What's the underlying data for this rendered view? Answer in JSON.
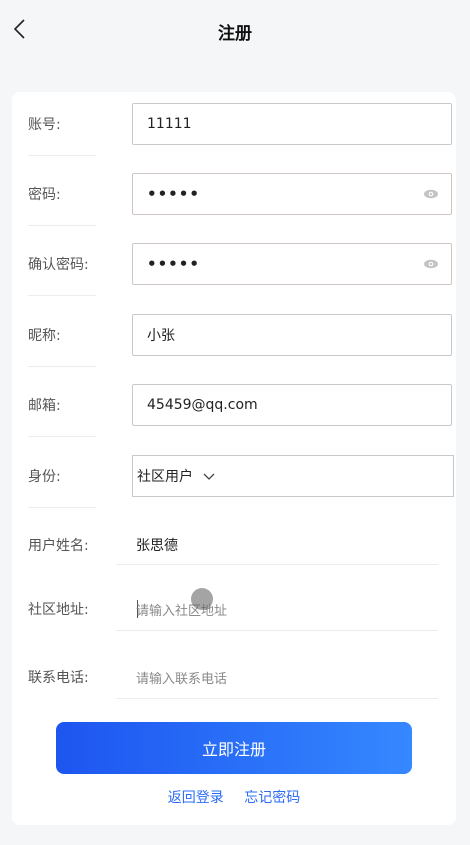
{
  "header": {
    "title": "注册"
  },
  "form": {
    "account": {
      "label": "账号:",
      "value": "11111"
    },
    "password": {
      "label": "密码:",
      "value": "•••••"
    },
    "confirm_password": {
      "label": "确认密码:",
      "value": "•••••"
    },
    "nickname": {
      "label": "昵称:",
      "value": "小张"
    },
    "email": {
      "label": "邮箱:",
      "value": "45459@qq.com"
    },
    "identity": {
      "label": "身份:",
      "selected": "社区用户"
    },
    "username": {
      "label": "用户姓名:",
      "value": "张思德"
    },
    "address": {
      "label": "社区地址:",
      "placeholder": "请输入社区地址"
    },
    "phone": {
      "label": "联系电话:",
      "placeholder": "请输入联系电话"
    }
  },
  "actions": {
    "submit_label": "立即注册",
    "back_to_login": "返回登录",
    "forgot_password": "忘记密码"
  },
  "colors": {
    "accent": "#2a6cf6",
    "gradient_start": "#1d55f0",
    "gradient_end": "#3588ff"
  }
}
